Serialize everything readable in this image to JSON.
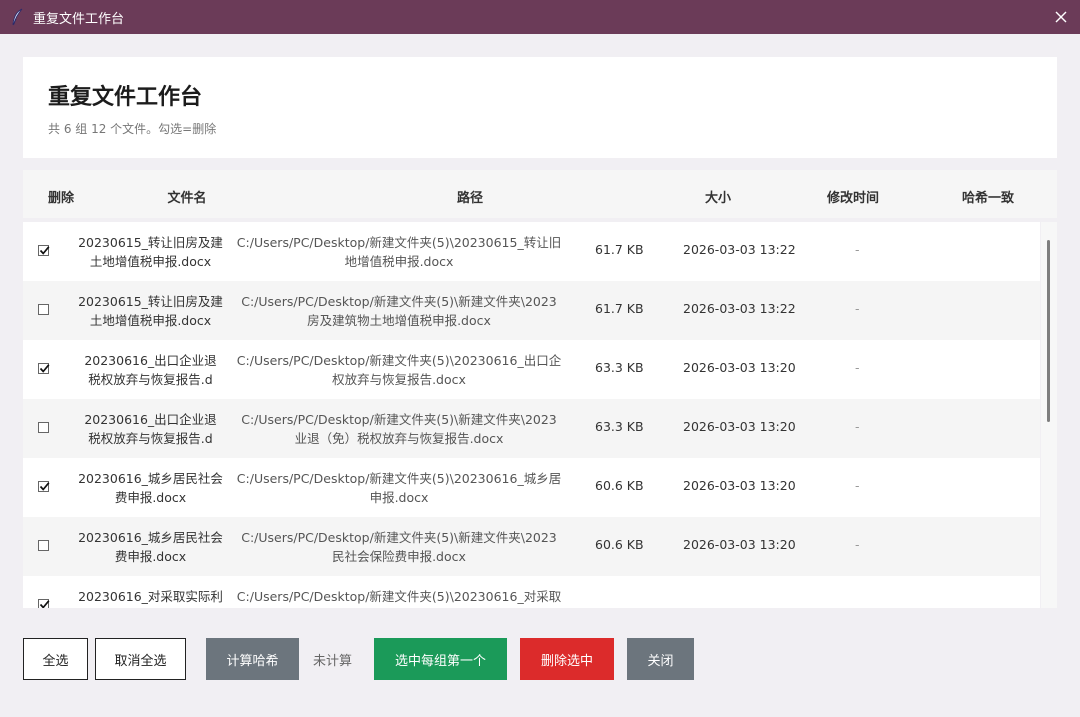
{
  "window": {
    "title": "重复文件工作台"
  },
  "header": {
    "title": "重复文件工作台",
    "subtitle": "共 6 组 12 个文件。勾选=删除"
  },
  "table": {
    "columns": [
      "删除",
      "文件名",
      "路径",
      "大小",
      "修改时间",
      "哈希一致"
    ],
    "rows": [
      {
        "checked": true,
        "name1": "20230615_转让旧房及建",
        "name2": "土地增值税申报.docx",
        "path1": "C:/Users/PC/Desktop/新建文件夹(5)\\20230615_转让旧",
        "path2": "地增值税申报.docx",
        "size": "61.7 KB",
        "mtime": "2026-03-03 13:22",
        "hash": "-"
      },
      {
        "checked": false,
        "name1": "20230615_转让旧房及建",
        "name2": "土地增值税申报.docx",
        "path1": "C:/Users/PC/Desktop/新建文件夹(5)\\新建文件夹\\2023",
        "path2": "房及建筑物土地增值税申报.docx",
        "size": "61.7 KB",
        "mtime": "2026-03-03 13:22",
        "hash": "-"
      },
      {
        "checked": true,
        "name1": "20230616_出口企业退",
        "name2": "税权放弃与恢复报告.d",
        "path1": "C:/Users/PC/Desktop/新建文件夹(5)\\20230616_出口企",
        "path2": "权放弃与恢复报告.docx",
        "size": "63.3 KB",
        "mtime": "2026-03-03 13:20",
        "hash": "-"
      },
      {
        "checked": false,
        "name1": "20230616_出口企业退",
        "name2": "税权放弃与恢复报告.d",
        "path1": "C:/Users/PC/Desktop/新建文件夹(5)\\新建文件夹\\2023",
        "path2": "业退（免）税权放弃与恢复报告.docx",
        "size": "63.3 KB",
        "mtime": "2026-03-03 13:20",
        "hash": "-"
      },
      {
        "checked": true,
        "name1": "20230616_城乡居民社会",
        "name2": "费申报.docx",
        "path1": "C:/Users/PC/Desktop/新建文件夹(5)\\20230616_城乡居",
        "path2": "申报.docx",
        "size": "60.6 KB",
        "mtime": "2026-03-03 13:20",
        "hash": "-"
      },
      {
        "checked": false,
        "name1": "20230616_城乡居民社会",
        "name2": "费申报.docx",
        "path1": "C:/Users/PC/Desktop/新建文件夹(5)\\新建文件夹\\2023",
        "path2": "民社会保险费申报.docx",
        "size": "60.6 KB",
        "mtime": "2026-03-03 13:20",
        "hash": "-"
      },
      {
        "checked": true,
        "name1": "20230616_对采取实际利",
        "name2": "",
        "path1": "C:/Users/PC/Desktop/新建文件夹(5)\\20230616_对采取",
        "path2": "",
        "size": "",
        "mtime": "",
        "hash": ""
      }
    ]
  },
  "footer": {
    "select_all": "全选",
    "deselect_all": "取消全选",
    "compute_hash": "计算哈希",
    "hash_status": "未计算",
    "select_first": "选中每组第一个",
    "delete_selected": "删除选中",
    "close": "关闭"
  },
  "colors": {
    "titlebar": "#6b3b58",
    "green": "#1b9a59",
    "red": "#dc2b2b",
    "gray": "#6c757d"
  },
  "icons": {
    "app": "feather-icon",
    "close": "close-icon",
    "check": "check-icon"
  }
}
